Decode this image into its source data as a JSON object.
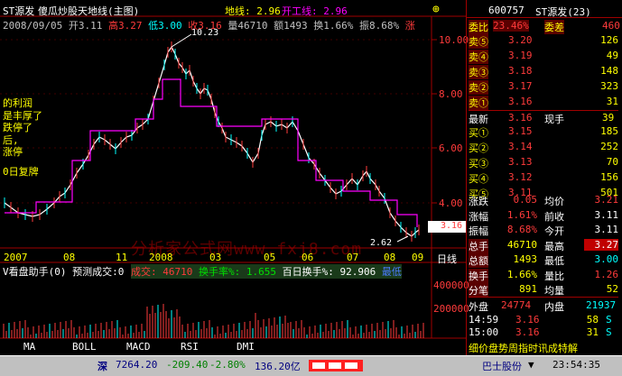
{
  "header": {
    "app_title": "ST源发",
    "formula_title": "傻瓜炒股天地线(主图)",
    "ground_line": "地线: 2.96",
    "sky_line": "开工线: 2.96",
    "date": "2008/09/05",
    "open": "开3.11",
    "high": "高3.27",
    "low": "低3.00",
    "close": "收3.16",
    "volume": "量46710",
    "amount": "额1493",
    "turnover": "换1.66%",
    "amplitude": "振8.68%",
    "rise_tag": "涨",
    "pin_icon": "pin-icon"
  },
  "annotations": {
    "high_label": "10.23",
    "low_label": "2.62",
    "price_flag": "3.16",
    "text_lines": [
      "的利润",
      "是丰厚了",
      "跌停了",
      "后,",
      "涨停",
      "0日复牌"
    ],
    "watermark": "分析家公式网www.fxj8.com"
  },
  "price_axis": [
    "10.00",
    "8.00",
    "6.00",
    "4.00"
  ],
  "time_axis": [
    "2007",
    "08",
    "11",
    "2008",
    "03",
    "05",
    "06",
    "07",
    "08",
    "09"
  ],
  "time_axis_right": "日线",
  "volume_panel": {
    "title": "V看盘助手(0) 预测成交:0",
    "vol_label": "成交: 46710",
    "turnover_label": "换手率%: 1.655",
    "hundred_turn": "百日换手%: 92.906",
    "tail_label": "最低",
    "axis": [
      "400000",
      "200000"
    ]
  },
  "indicator_tabs": [
    "MA",
    "BOLL",
    "MACD",
    "RSI",
    "DMI"
  ],
  "quote": {
    "code": "600757",
    "name": "ST源发(23)",
    "wei_bi_label": "委比",
    "wei_bi": "23.46%",
    "wei_cha_label": "委差",
    "wei_cha": "460",
    "sells": [
      {
        "label": "卖⑤",
        "price": "3.20",
        "vol": "126"
      },
      {
        "label": "卖④",
        "price": "3.19",
        "vol": "49"
      },
      {
        "label": "卖③",
        "price": "3.18",
        "vol": "148"
      },
      {
        "label": "卖②",
        "price": "3.17",
        "vol": "323"
      },
      {
        "label": "卖①",
        "price": "3.16",
        "vol": "31"
      }
    ],
    "last_label": "最新",
    "last": "3.16",
    "cur_vol_label": "现手",
    "cur_vol": "39",
    "buys": [
      {
        "label": "买①",
        "price": "3.15",
        "vol": "185"
      },
      {
        "label": "买②",
        "price": "3.14",
        "vol": "252"
      },
      {
        "label": "买③",
        "price": "3.13",
        "vol": "70"
      },
      {
        "label": "买④",
        "price": "3.12",
        "vol": "156"
      },
      {
        "label": "买⑤",
        "price": "3.11",
        "vol": "501"
      }
    ],
    "stats": [
      {
        "l1": "涨跌",
        "v1": "0.05",
        "l2": "均价",
        "v2": "3.21"
      },
      {
        "l1": "涨幅",
        "v1": "1.61%",
        "l2": "前收",
        "v2": "3.11"
      },
      {
        "l1": "振幅",
        "v1": "8.68%",
        "l2": "今开",
        "v2": "3.11"
      },
      {
        "l1": "总手",
        "v1": "46710",
        "l2": "最高",
        "v2": "3.27"
      },
      {
        "l1": "总额",
        "v1": "1493",
        "l2": "最低",
        "v2": "3.00"
      },
      {
        "l1": "换手",
        "v1": "1.66%",
        "l2": "量比",
        "v2": "1.26"
      },
      {
        "l1": "分笔",
        "v1": "891",
        "l2": "均量",
        "v2": "52"
      }
    ],
    "outer_label": "外盘",
    "outer": "24774",
    "inner_label": "内盘",
    "inner": "21937",
    "ticks": [
      {
        "time": "14:59",
        "price": "3.16",
        "vol": "58",
        "dir": "S"
      },
      {
        "time": "15:00",
        "price": "3.16",
        "vol": "31",
        "dir": "S"
      }
    ],
    "right_tabs": "细价盘势周指时讯成特解"
  },
  "status_bar": {
    "index_name": "深",
    "index_value": "7264.20",
    "index_change": "-209.40",
    "index_pct": "-2.80%",
    "index_amount": "136.20亿",
    "stock_name": "巴士股份",
    "time": "23:54:35"
  },
  "colors": {
    "up": "#ff3b3b",
    "down": "#00ffff",
    "axis_red": "#a00000",
    "sky_line": "#ff00ff",
    "panel_bg": "#000000"
  }
}
